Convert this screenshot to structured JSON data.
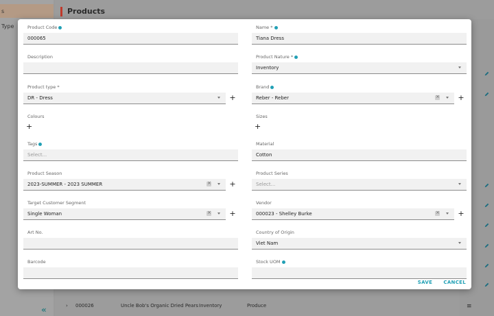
{
  "background": {
    "sidebar_items": [
      "s",
      "Type"
    ],
    "page_title": "Products",
    "bottom_row": {
      "code": "000026",
      "name": "Uncle Bob's Organic Dried Pears",
      "nature": "Inventory",
      "category": "Produce"
    }
  },
  "form": {
    "left": [
      {
        "key": "product_code",
        "label": "Product Code",
        "info": true,
        "value": "000065"
      },
      {
        "key": "description",
        "label": "Description",
        "value": ""
      },
      {
        "key": "product_type",
        "label": "Product type *",
        "value": "DR - Dress"
      },
      {
        "key": "colours",
        "label": "Colours"
      },
      {
        "key": "tags",
        "label": "Tags",
        "info": true,
        "placeholder": "Select..."
      },
      {
        "key": "product_season",
        "label": "Product Season",
        "value": "2023-SUMMER - 2023 SUMMER"
      },
      {
        "key": "target_customer_segment",
        "label": "Target Customer Segment",
        "value": "Single Woman"
      },
      {
        "key": "art_no",
        "label": "Art No.",
        "value": ""
      },
      {
        "key": "barcode",
        "label": "Barcode",
        "value": ""
      }
    ],
    "right": [
      {
        "key": "name",
        "label": "Name *",
        "info": true,
        "value": "Tiana Dress"
      },
      {
        "key": "product_nature",
        "label": "Product Nature *",
        "info": true,
        "value": "Inventory"
      },
      {
        "key": "brand",
        "label": "Brand",
        "info": true,
        "value": "Reber - Reber"
      },
      {
        "key": "sizes",
        "label": "Sizes"
      },
      {
        "key": "material",
        "label": "Material",
        "value": "Cotton"
      },
      {
        "key": "product_series",
        "label": "Product Series",
        "placeholder": "Select..."
      },
      {
        "key": "vendor",
        "label": "Vendor",
        "value": "000023 - Shelley Burke"
      },
      {
        "key": "country_of_origin",
        "label": "Country of Origin",
        "value": "Viet Nam"
      },
      {
        "key": "stock_uom",
        "label": "Stock UOM",
        "info": true,
        "value": ""
      }
    ]
  },
  "footer": {
    "save_label": "SAVE",
    "cancel_label": "CANCEL"
  },
  "colors": {
    "accent": "#21a0b5",
    "title_bar": "#c0392b"
  }
}
